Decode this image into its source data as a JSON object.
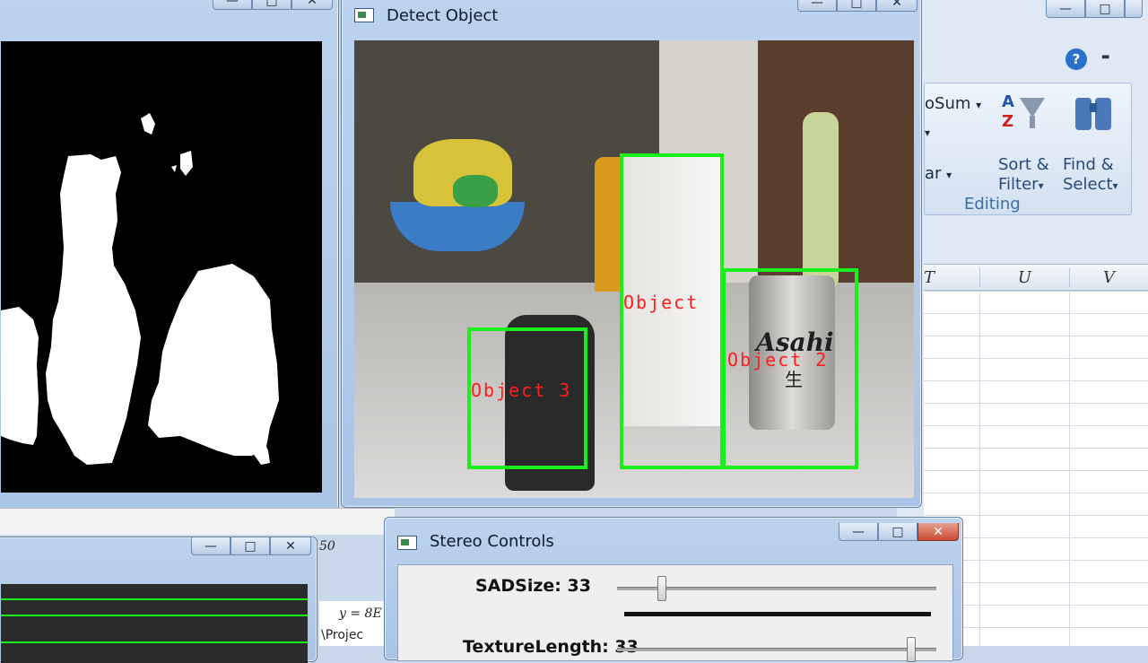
{
  "excel": {
    "ribbon": {
      "autosum": "oSum",
      "autosum_arrow": "▾",
      "fill_arrow": "▾",
      "clear": "ar",
      "clear_arrow": "▾",
      "sort_label1": "Sort &",
      "sort_label2": "Filter",
      "sort_arrow": "▾",
      "find_label1": "Find &",
      "find_label2": "Select",
      "find_arrow": "▾",
      "group_label": "Editing",
      "help": "?",
      "min": "▬"
    },
    "columns": [
      "T",
      "U",
      "V"
    ],
    "formula_text": "y = 8E"
  },
  "disparity_window": {
    "title": ""
  },
  "detect_window": {
    "title": "Detect Object",
    "labels": {
      "object1": "Object",
      "object2": "Object 2",
      "object3": "Object 3"
    },
    "can_brand": "Asahi",
    "can_sub": "生"
  },
  "bottom_left_window": {
    "axis_tick": "50",
    "path_text": "\\Projec"
  },
  "stereo_controls": {
    "title": "Stereo Controls",
    "sad_label": "SADSize: 33",
    "sad_level_percent": 14,
    "texture_label": "TextureLength: 33",
    "texture_level_percent": 92
  },
  "icons": {
    "min": "—",
    "max": "□",
    "close": "✕"
  },
  "colors": {
    "detect_box": "#19f019",
    "detect_label": "#ff1d1d",
    "title_bar": "#bcd3ee"
  }
}
